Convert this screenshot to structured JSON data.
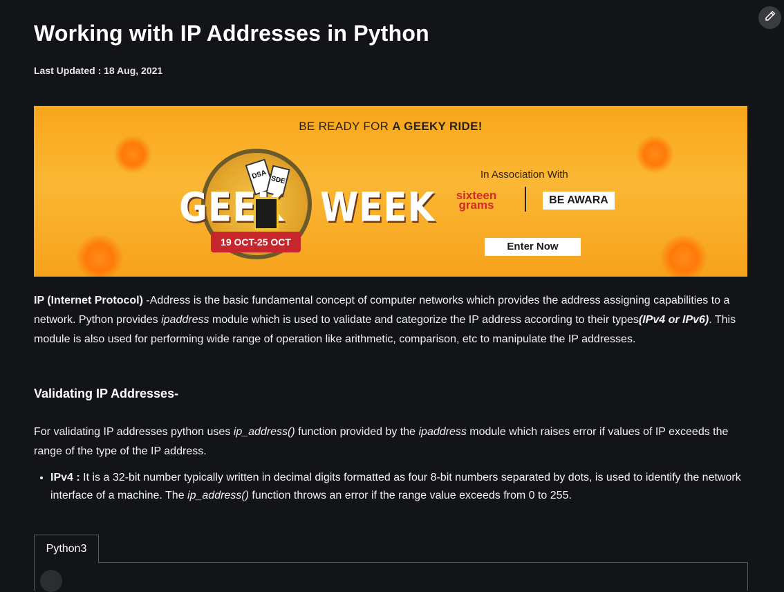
{
  "page": {
    "title": "Working with IP Addresses in Python",
    "last_updated": "Last Updated : 18 Aug, 2021"
  },
  "banner": {
    "headline_prefix": "BE READY FOR ",
    "headline_bold": "A GEEKY RIDE!",
    "logo_left": "GEEK",
    "logo_right": "WEEK",
    "dates": "19 OCT-25 OCT",
    "association": "In Association With",
    "partner1": "sixteen grams",
    "partner2": "BE AWARA",
    "cta": "Enter Now",
    "card1": "DSA",
    "card2": "SDE"
  },
  "intro": {
    "term": "IP (Internet Protocol)",
    "text1": " -Address is the basic fundamental concept of computer networks which provides the address assigning capabilities to a network. Python provides ",
    "module": "ipaddress",
    "text2": " module which is used to validate and categorize the IP address according to their types",
    "types": "(IPv4 or IPv6)",
    "text3": ". This module is also used for performing wide range of operation like arithmetic, comparison, etc to manipulate the IP addresses."
  },
  "section": {
    "heading": "Validating IP Addresses-",
    "para_a": "For validating IP addresses python uses ",
    "func": "ip_address()",
    "para_b": " function provided by the ",
    "module": "ipaddress",
    "para_c": " module which raises error if values of IP exceeds the range of the type of the IP address."
  },
  "bullet": {
    "label": "IPv4 : ",
    "text_a": "It is a 32-bit number typically written in decimal digits formatted as four 8-bit numbers separated by dots, is used to identify the network interface of a machine. The ",
    "func": "ip_address()",
    "text_b": " function throws an error if the range value exceeds from 0 to 255."
  },
  "code": {
    "tab_label": "Python3"
  },
  "colors": {
    "background": "#131417",
    "banner_orange": "#f8a61a",
    "ribbon_red": "#c8262d"
  },
  "icons": {
    "edit": "pencil-icon"
  }
}
